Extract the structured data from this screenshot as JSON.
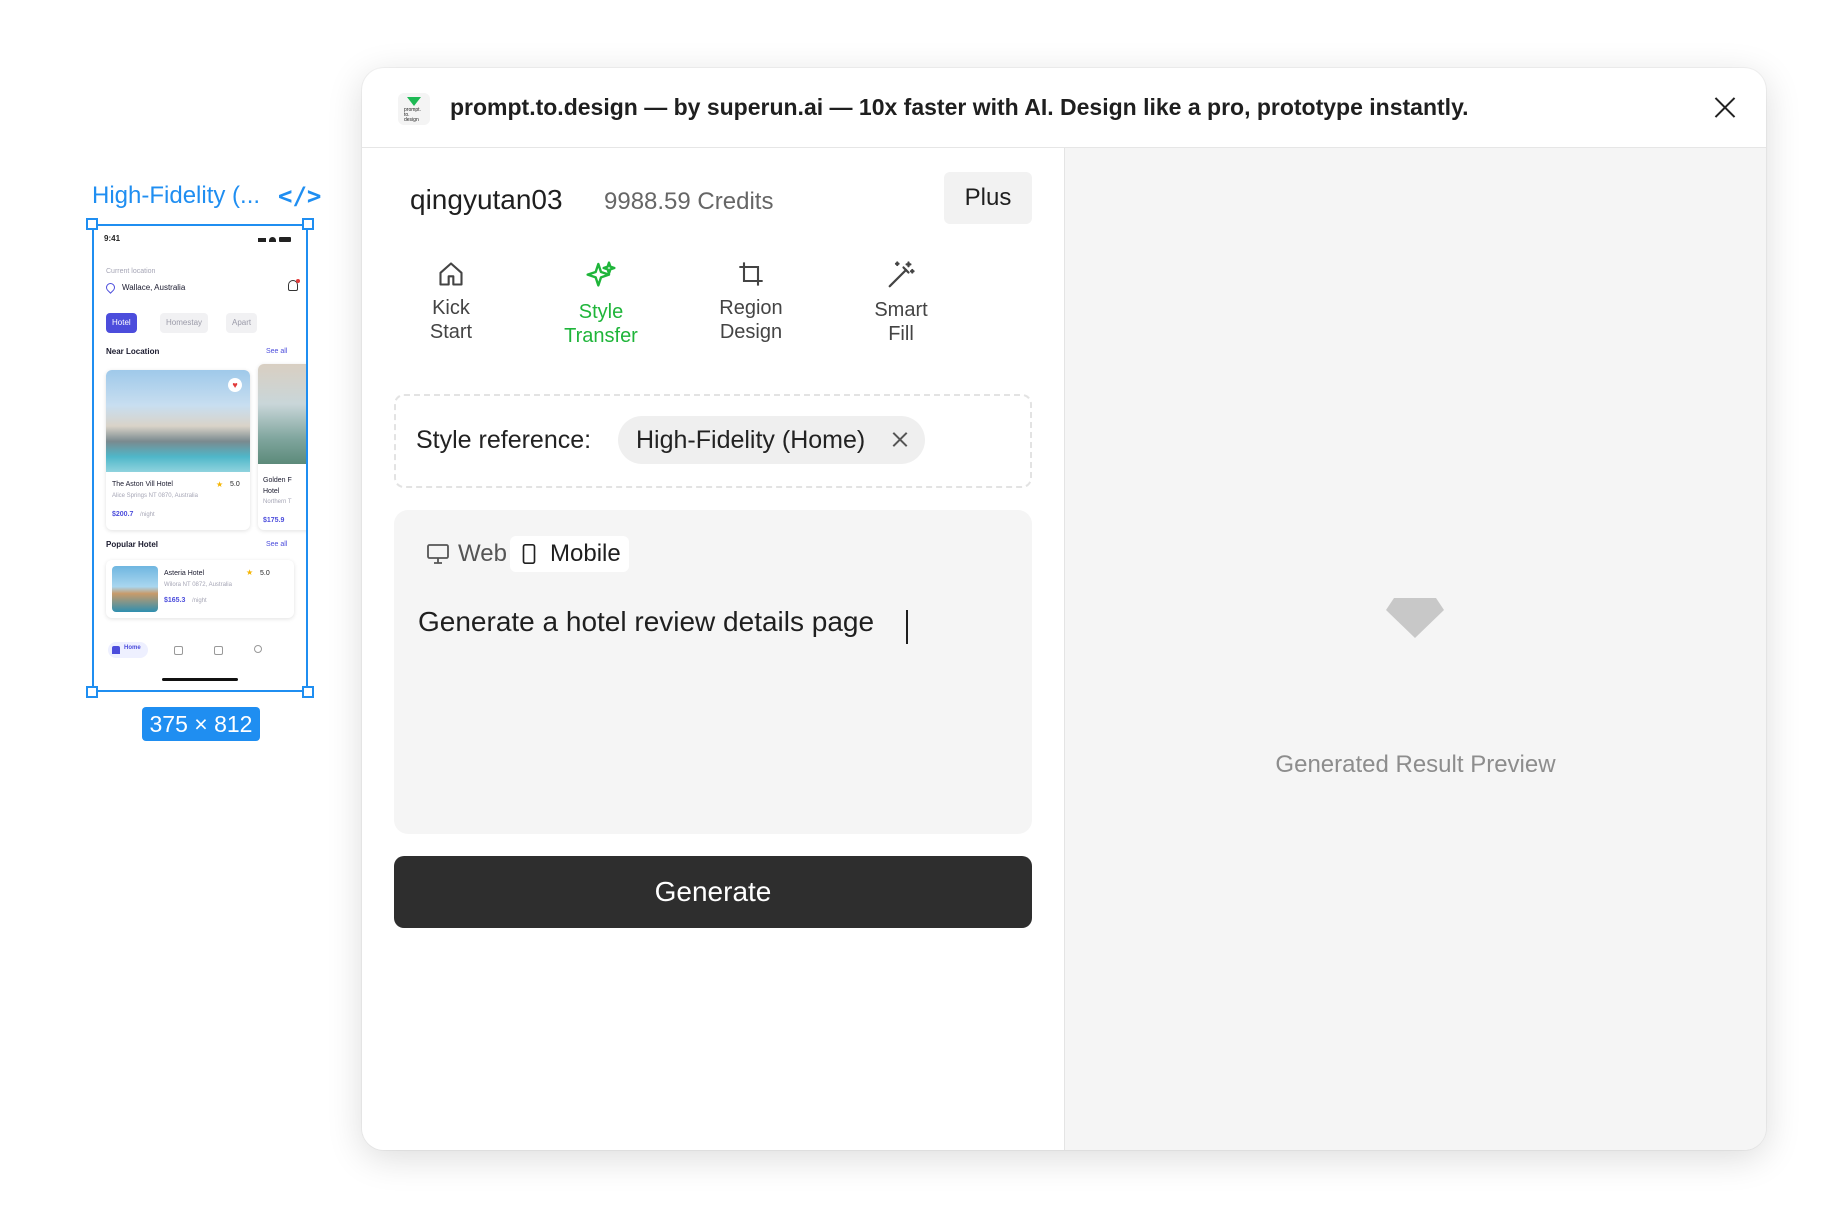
{
  "canvas": {
    "frame_title": "High-Fidelity (...",
    "code_icon": "</>",
    "size_badge": "375 × 812",
    "mini_app": {
      "time": "9:41",
      "location_caption": "Current location",
      "location": "Wallace, Australia",
      "categories": [
        "Hotel",
        "Homestay",
        "Apart"
      ],
      "near_location_title": "Near Location",
      "see_all": "See all",
      "card1": {
        "name": "The Aston Vill Hotel",
        "rating": "5.0",
        "address": "Alice Springs NT 0870, Australia",
        "price": "$200.7",
        "unit": "/night"
      },
      "card2": {
        "name_line1": "Golden F",
        "name_line2": "Hotel",
        "address": "Northern T",
        "price": "$175.9",
        "unit": "/"
      },
      "popular_title": "Popular Hotel",
      "popular": {
        "name": "Asteria Hotel",
        "rating": "5.0",
        "address": "Wilora NT 0872, Australia",
        "price": "$165.3",
        "unit": "/night"
      },
      "nav_home": "Home"
    }
  },
  "plugin": {
    "title": "prompt.to.design — by superun.ai — 10x faster with AI. Design like a pro, prototype instantly.",
    "logo_text": "prompt.\nto.\ndesign",
    "username": "qingyutan03",
    "credits": "9988.59 Credits",
    "plan_button": "Plus",
    "tools": [
      {
        "label": "Kick\nStart",
        "icon": "home-icon"
      },
      {
        "label": "Style\nTransfer",
        "icon": "sparkles-icon"
      },
      {
        "label": "Region\nDesign",
        "icon": "crop-icon"
      },
      {
        "label": "Smart\nFill",
        "icon": "magic-wand-icon"
      }
    ],
    "active_tool": "Style\nTransfer",
    "style_reference_label": "Style reference:",
    "style_reference_value": "High-Fidelity (Home)",
    "device_tabs": [
      "Web",
      "Mobile"
    ],
    "selected_device": "Mobile",
    "prompt_value": "Generate a hotel review details page",
    "generate_button": "Generate",
    "preview_label": "Generated Result Preview",
    "colors": {
      "accent": "#1fb53a",
      "selection": "#1f8ef1",
      "button": "#2e2e2e",
      "mini_app_primary": "#4c4ddc"
    }
  }
}
